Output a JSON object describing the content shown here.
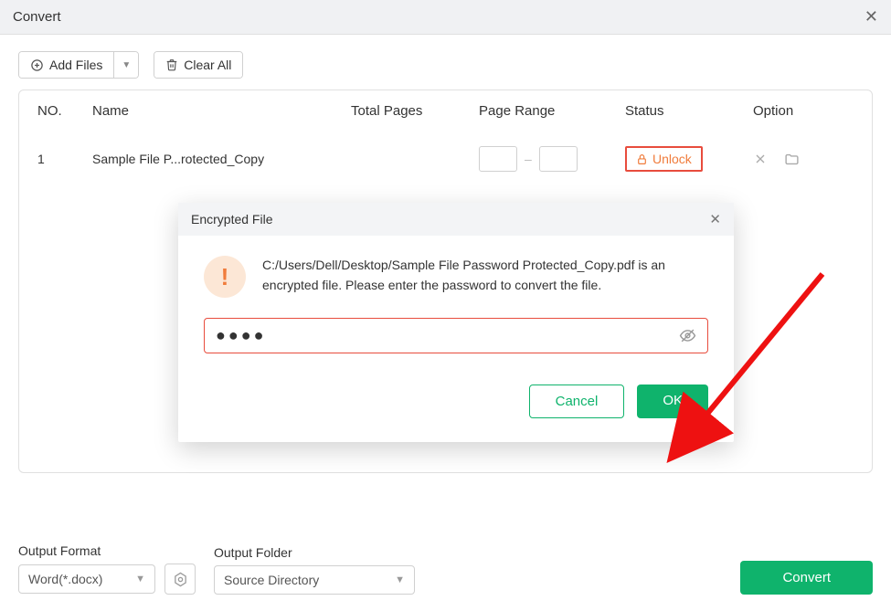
{
  "window": {
    "title": "Convert"
  },
  "toolbar": {
    "add_files_label": "Add Files",
    "clear_all_label": "Clear All"
  },
  "table": {
    "headers": {
      "no": "NO.",
      "name": "Name",
      "total_pages": "Total Pages",
      "page_range": "Page Range",
      "status": "Status",
      "option": "Option"
    },
    "rows": [
      {
        "no": "1",
        "name": "Sample File P...rotected_Copy",
        "range_from": "",
        "range_to": "",
        "status_label": "Unlock"
      }
    ]
  },
  "output": {
    "format_label": "Output Format",
    "format_value": "Word(*.docx)",
    "folder_label": "Output Folder",
    "folder_value": "Source Directory"
  },
  "convert_button": "Convert",
  "dialog": {
    "title": "Encrypted File",
    "message": "C:/Users/Dell/Desktop/Sample File Password Protected_Copy.pdf is an encrypted file. Please enter the password to convert the file.",
    "password_value": "●●●●",
    "cancel_label": "Cancel",
    "ok_label": "OK"
  },
  "colors": {
    "accent": "#0fb36c",
    "danger": "#e84c3d",
    "warn": "#f07c3c"
  }
}
